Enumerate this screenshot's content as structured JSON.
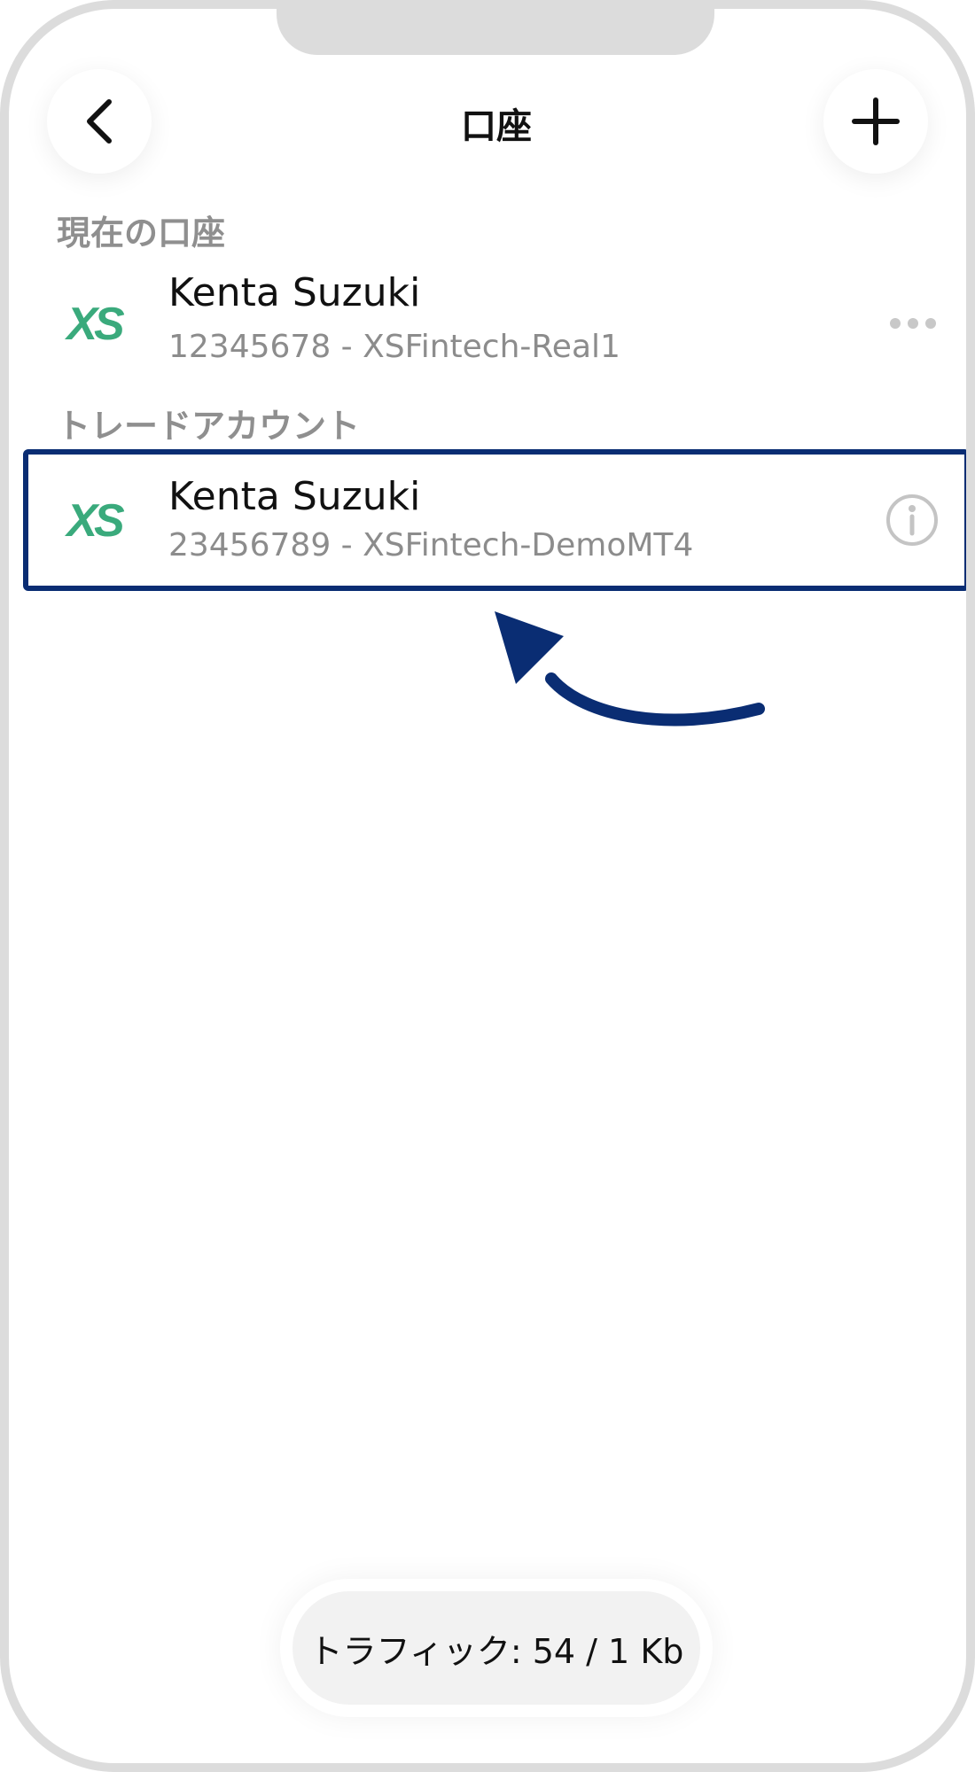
{
  "header": {
    "title": "口座",
    "back_icon": "chevron-left-icon",
    "add_icon": "plus-icon"
  },
  "sections": {
    "current_label": "現在の口座",
    "trade_label": "トレードアカウント"
  },
  "current_account": {
    "logo": "XS",
    "name": "Kenta Suzuki",
    "detail": "12345678 - XSFintech-Real1",
    "action_icon": "more-horizontal-icon"
  },
  "trade_account": {
    "logo": "XS",
    "name": "Kenta Suzuki",
    "detail": "23456789 - XSFintech-DemoMT4",
    "action_icon": "info-icon"
  },
  "footer": {
    "traffic": "トラフィック: 54 / 1 Kb"
  },
  "colors": {
    "logo_green": "#3aaa7c",
    "highlight_navy": "#0a2d73",
    "muted_text": "#8c8c8c"
  }
}
